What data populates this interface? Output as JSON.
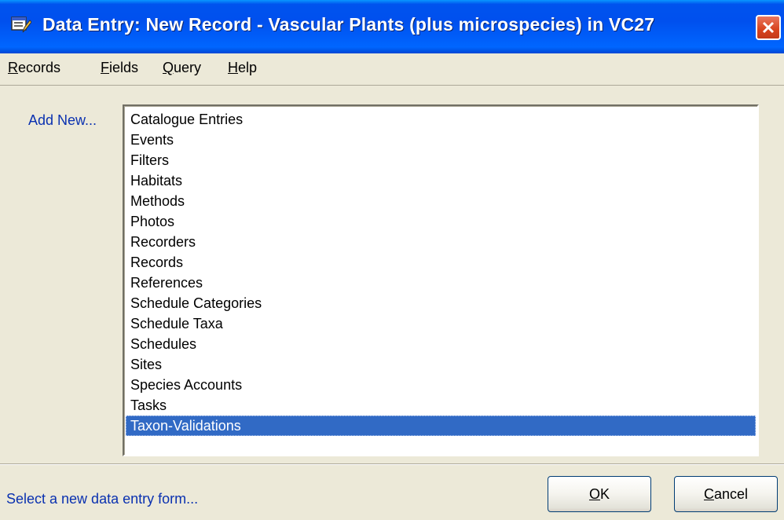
{
  "window": {
    "title": "Data Entry: New Record - Vascular Plants (plus microspecies) in VC27",
    "icon": "data-entry-form-icon"
  },
  "menu": [
    "Records",
    "Fields",
    "Query",
    "Help"
  ],
  "add_new_label": "Add New...",
  "list": {
    "items": [
      "Catalogue Entries",
      "Events",
      "Filters",
      "Habitats",
      "Methods",
      "Photos",
      "Recorders",
      "Records",
      "References",
      "Schedule Categories",
      "Schedule Taxa",
      "Schedules",
      "Sites",
      "Species Accounts",
      "Tasks",
      "Taxon-Validations"
    ],
    "selected": "Taxon-Validations"
  },
  "status_text": "Select a new data entry form...",
  "buttons": {
    "ok": "OK",
    "cancel": "Cancel"
  },
  "colors": {
    "title_bar": "#0054e3",
    "selection": "#316ac5",
    "label_text": "#0a31b0",
    "dialog_bg": "#ece9d8"
  }
}
